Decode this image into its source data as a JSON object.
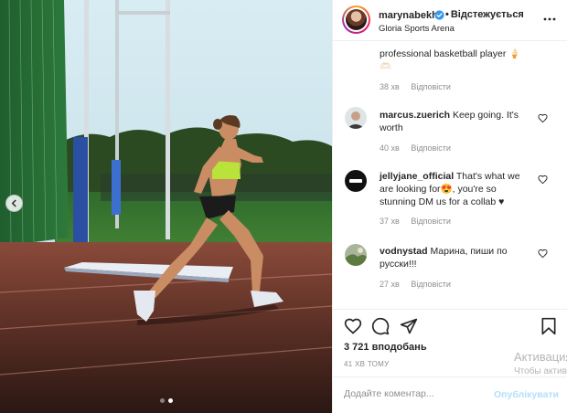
{
  "post": {
    "username": "marynabekh",
    "follow_separator": "•",
    "follow_label": "Відстежується",
    "location": "Gloria Sports Arena"
  },
  "icons": {
    "verified": "verified-badge-icon",
    "more": "more-options-icon",
    "like": "heart-icon",
    "comment": "comment-bubble-icon",
    "share": "paper-plane-icon",
    "save": "bookmark-icon",
    "prev": "chevron-left-icon"
  },
  "colors": {
    "accent": "#0095f6",
    "verified": "#3897f0",
    "muted": "#8e8e8e"
  },
  "carousel": {
    "slides": 2,
    "active": 2
  },
  "comments": [
    {
      "username": "",
      "text": "professional basketball player 🍦",
      "extra": "🫶🏻",
      "age": "38 хв",
      "reply": "Відповісти"
    },
    {
      "username": "marcus.zuerich",
      "text": "Keep going. It's worth",
      "age": "40 хв",
      "reply": "Відповісти"
    },
    {
      "username": "jellyjane_official",
      "text": "That's what we are looking for😍, you're so stunning DM us for a collab ♥",
      "age": "37 хв",
      "reply": "Відповісти"
    },
    {
      "username": "vodnystad",
      "text": "Марина, пиши по русски!!!",
      "age": "27 хв",
      "reply": "Відповісти"
    }
  ],
  "likes": "3 721 вподобань",
  "timestamp": "41 ХВ ТОМУ",
  "add_comment": {
    "placeholder": "Додайте коментар...",
    "publish_label": "Опублікувати"
  },
  "overlay": {
    "line1": "Активация",
    "line2": "Чтобы активировать параметры"
  }
}
